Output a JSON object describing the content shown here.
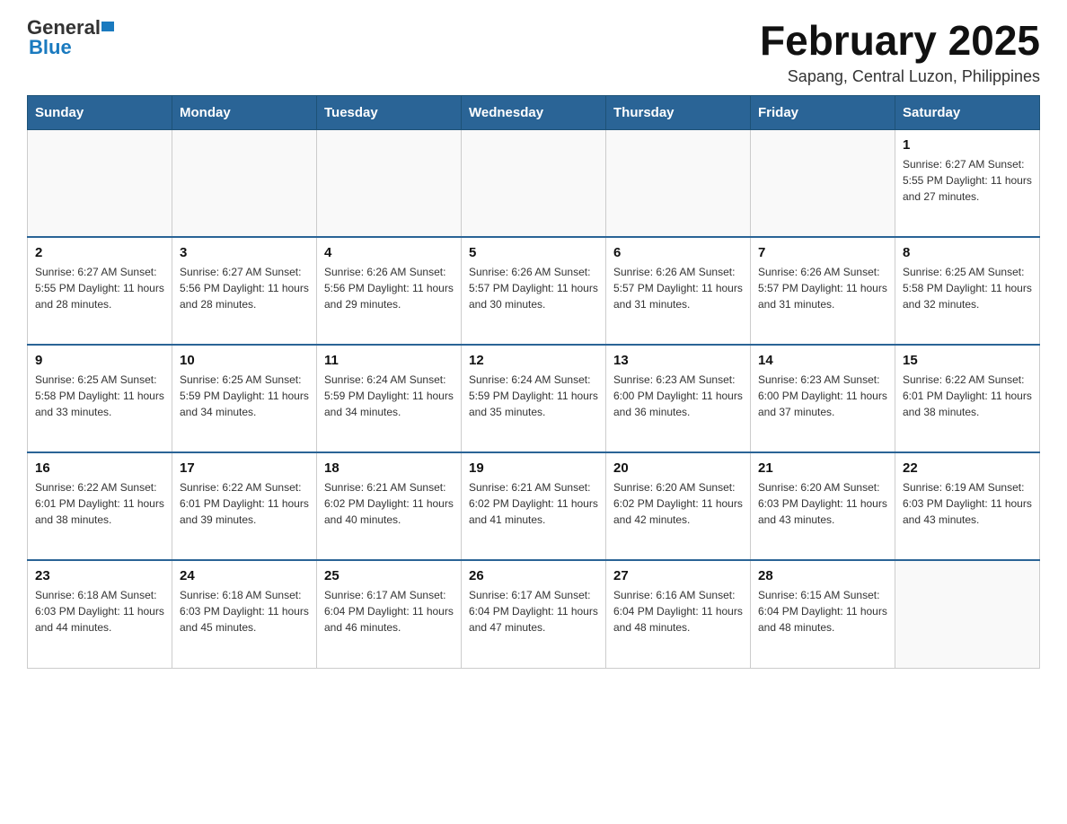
{
  "header": {
    "logo_general": "General",
    "logo_blue": "Blue",
    "title": "February 2025",
    "subtitle": "Sapang, Central Luzon, Philippines"
  },
  "weekdays": [
    "Sunday",
    "Monday",
    "Tuesday",
    "Wednesday",
    "Thursday",
    "Friday",
    "Saturday"
  ],
  "weeks": [
    [
      {
        "day": "",
        "info": ""
      },
      {
        "day": "",
        "info": ""
      },
      {
        "day": "",
        "info": ""
      },
      {
        "day": "",
        "info": ""
      },
      {
        "day": "",
        "info": ""
      },
      {
        "day": "",
        "info": ""
      },
      {
        "day": "1",
        "info": "Sunrise: 6:27 AM\nSunset: 5:55 PM\nDaylight: 11 hours\nand 27 minutes."
      }
    ],
    [
      {
        "day": "2",
        "info": "Sunrise: 6:27 AM\nSunset: 5:55 PM\nDaylight: 11 hours\nand 28 minutes."
      },
      {
        "day": "3",
        "info": "Sunrise: 6:27 AM\nSunset: 5:56 PM\nDaylight: 11 hours\nand 28 minutes."
      },
      {
        "day": "4",
        "info": "Sunrise: 6:26 AM\nSunset: 5:56 PM\nDaylight: 11 hours\nand 29 minutes."
      },
      {
        "day": "5",
        "info": "Sunrise: 6:26 AM\nSunset: 5:57 PM\nDaylight: 11 hours\nand 30 minutes."
      },
      {
        "day": "6",
        "info": "Sunrise: 6:26 AM\nSunset: 5:57 PM\nDaylight: 11 hours\nand 31 minutes."
      },
      {
        "day": "7",
        "info": "Sunrise: 6:26 AM\nSunset: 5:57 PM\nDaylight: 11 hours\nand 31 minutes."
      },
      {
        "day": "8",
        "info": "Sunrise: 6:25 AM\nSunset: 5:58 PM\nDaylight: 11 hours\nand 32 minutes."
      }
    ],
    [
      {
        "day": "9",
        "info": "Sunrise: 6:25 AM\nSunset: 5:58 PM\nDaylight: 11 hours\nand 33 minutes."
      },
      {
        "day": "10",
        "info": "Sunrise: 6:25 AM\nSunset: 5:59 PM\nDaylight: 11 hours\nand 34 minutes."
      },
      {
        "day": "11",
        "info": "Sunrise: 6:24 AM\nSunset: 5:59 PM\nDaylight: 11 hours\nand 34 minutes."
      },
      {
        "day": "12",
        "info": "Sunrise: 6:24 AM\nSunset: 5:59 PM\nDaylight: 11 hours\nand 35 minutes."
      },
      {
        "day": "13",
        "info": "Sunrise: 6:23 AM\nSunset: 6:00 PM\nDaylight: 11 hours\nand 36 minutes."
      },
      {
        "day": "14",
        "info": "Sunrise: 6:23 AM\nSunset: 6:00 PM\nDaylight: 11 hours\nand 37 minutes."
      },
      {
        "day": "15",
        "info": "Sunrise: 6:22 AM\nSunset: 6:01 PM\nDaylight: 11 hours\nand 38 minutes."
      }
    ],
    [
      {
        "day": "16",
        "info": "Sunrise: 6:22 AM\nSunset: 6:01 PM\nDaylight: 11 hours\nand 38 minutes."
      },
      {
        "day": "17",
        "info": "Sunrise: 6:22 AM\nSunset: 6:01 PM\nDaylight: 11 hours\nand 39 minutes."
      },
      {
        "day": "18",
        "info": "Sunrise: 6:21 AM\nSunset: 6:02 PM\nDaylight: 11 hours\nand 40 minutes."
      },
      {
        "day": "19",
        "info": "Sunrise: 6:21 AM\nSunset: 6:02 PM\nDaylight: 11 hours\nand 41 minutes."
      },
      {
        "day": "20",
        "info": "Sunrise: 6:20 AM\nSunset: 6:02 PM\nDaylight: 11 hours\nand 42 minutes."
      },
      {
        "day": "21",
        "info": "Sunrise: 6:20 AM\nSunset: 6:03 PM\nDaylight: 11 hours\nand 43 minutes."
      },
      {
        "day": "22",
        "info": "Sunrise: 6:19 AM\nSunset: 6:03 PM\nDaylight: 11 hours\nand 43 minutes."
      }
    ],
    [
      {
        "day": "23",
        "info": "Sunrise: 6:18 AM\nSunset: 6:03 PM\nDaylight: 11 hours\nand 44 minutes."
      },
      {
        "day": "24",
        "info": "Sunrise: 6:18 AM\nSunset: 6:03 PM\nDaylight: 11 hours\nand 45 minutes."
      },
      {
        "day": "25",
        "info": "Sunrise: 6:17 AM\nSunset: 6:04 PM\nDaylight: 11 hours\nand 46 minutes."
      },
      {
        "day": "26",
        "info": "Sunrise: 6:17 AM\nSunset: 6:04 PM\nDaylight: 11 hours\nand 47 minutes."
      },
      {
        "day": "27",
        "info": "Sunrise: 6:16 AM\nSunset: 6:04 PM\nDaylight: 11 hours\nand 48 minutes."
      },
      {
        "day": "28",
        "info": "Sunrise: 6:15 AM\nSunset: 6:04 PM\nDaylight: 11 hours\nand 48 minutes."
      },
      {
        "day": "",
        "info": ""
      }
    ]
  ]
}
